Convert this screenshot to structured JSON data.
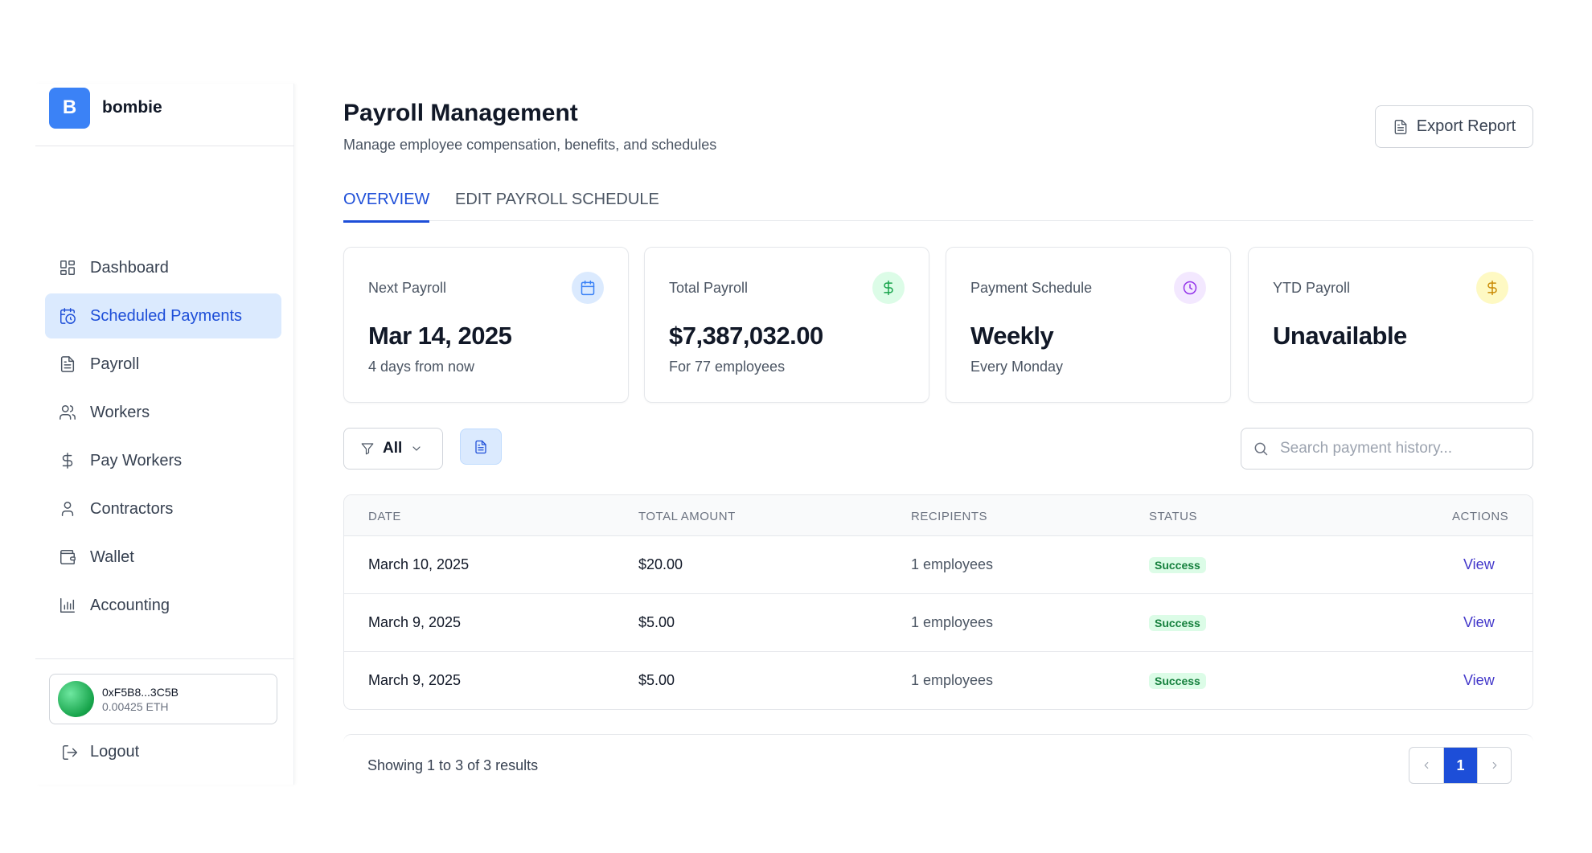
{
  "brand": {
    "initial": "B",
    "name": "bombie"
  },
  "sidebar": {
    "items": [
      {
        "label": "Dashboard",
        "icon": "dashboard-icon"
      },
      {
        "label": "Scheduled Payments",
        "icon": "calendar-clock-icon",
        "active": true
      },
      {
        "label": "Payroll",
        "icon": "document-icon"
      },
      {
        "label": "Workers",
        "icon": "users-icon"
      },
      {
        "label": "Pay Workers",
        "icon": "dollar-icon"
      },
      {
        "label": "Contractors",
        "icon": "user-icon"
      },
      {
        "label": "Wallet",
        "icon": "wallet-icon"
      },
      {
        "label": "Accounting",
        "icon": "bar-chart-icon"
      }
    ]
  },
  "wallet": {
    "address": "0xF5B8...3C5B",
    "balance": "0.00425 ETH"
  },
  "logout_label": "Logout",
  "header": {
    "title": "Payroll Management",
    "subtitle": "Manage employee compensation, benefits, and schedules",
    "export_label": "Export Report"
  },
  "tabs": [
    {
      "label": "OVERVIEW",
      "active": true
    },
    {
      "label": "EDIT PAYROLL SCHEDULE",
      "active": false
    }
  ],
  "cards": [
    {
      "label": "Next Payroll",
      "value": "Mar 14, 2025",
      "note": "4 days from now",
      "icon": "calendar-icon",
      "color": "#3b82f6",
      "bg": "#dbeafe"
    },
    {
      "label": "Total Payroll",
      "value": "$7,387,032.00",
      "note": "For 77 employees",
      "icon": "dollar-icon",
      "color": "#16a34a",
      "bg": "#dcfce7"
    },
    {
      "label": "Payment Schedule",
      "value": "Weekly",
      "note": "Every Monday",
      "icon": "clock-icon",
      "color": "#9333ea",
      "bg": "#f3e8ff"
    },
    {
      "label": "YTD Payroll",
      "value": "Unavailable",
      "note": "",
      "icon": "dollar-icon",
      "color": "#ca8a04",
      "bg": "#fef9c3"
    }
  ],
  "filter": {
    "label": "All"
  },
  "search": {
    "placeholder": "Search payment history..."
  },
  "table": {
    "headers": [
      "DATE",
      "TOTAL AMOUNT",
      "RECIPIENTS",
      "STATUS",
      "ACTIONS"
    ],
    "rows": [
      {
        "date": "March 10, 2025",
        "amount": "$20.00",
        "recipients": "1 employees",
        "status": "Success",
        "action": "View"
      },
      {
        "date": "March 9, 2025",
        "amount": "$5.00",
        "recipients": "1 employees",
        "status": "Success",
        "action": "View"
      },
      {
        "date": "March 9, 2025",
        "amount": "$5.00",
        "recipients": "1 employees",
        "status": "Success",
        "action": "View"
      }
    ]
  },
  "pagination": {
    "summary": "Showing 1 to 3 of 3 results",
    "current_page": "1"
  },
  "colors": {
    "accent": "#1d4ed8",
    "brand": "#3b82f6",
    "success_bg": "#dcfce7",
    "success_text": "#15803d"
  }
}
